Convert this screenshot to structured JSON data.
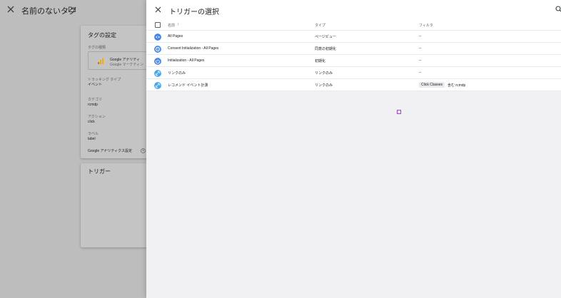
{
  "background": {
    "tag_title": "名前のないタグ",
    "config_card": {
      "title": "タグの設定",
      "type_label": "タグの種類",
      "type_name": "Google アナリティ",
      "type_sub": "Google マーケティン",
      "tracking_label": "トラッキング タイプ",
      "tracking_value": "イベント",
      "category_label": "カテゴリ",
      "category_value": "rcmdp",
      "action_label": "アクション",
      "action_value": "click",
      "label_label": "ラベル",
      "label_value": "label",
      "settings_label": "Google アナリティクス設定"
    },
    "trigger_card": {
      "title": "トリガー"
    }
  },
  "panel": {
    "title": "トリガーの選択",
    "columns": {
      "name": "名前",
      "type": "タイプ",
      "filter": "フィルタ"
    },
    "rows": [
      {
        "name": "All Pages",
        "type": "ページビュー",
        "filter": "--",
        "icon": "eye-icon",
        "color": "#4285f4"
      },
      {
        "name": "Consent Initialization - All Pages",
        "type": "同意の初期化",
        "filter": "--",
        "icon": "consent-icon",
        "color": "#4285f4"
      },
      {
        "name": "Initialization - All Pages",
        "type": "初期化",
        "filter": "--",
        "icon": "power-icon",
        "color": "#4285f4"
      },
      {
        "name": "リンクのみ",
        "type": "リンクのみ",
        "filter": "--",
        "icon": "link-icon",
        "color": "#42a5f5"
      },
      {
        "name": "レコメンド イベント計測",
        "type": "リンクのみ",
        "filter_chip": "Click Classes",
        "filter_rest": "含む rcmdp",
        "icon": "link-icon",
        "color": "#42a5f5"
      }
    ]
  }
}
